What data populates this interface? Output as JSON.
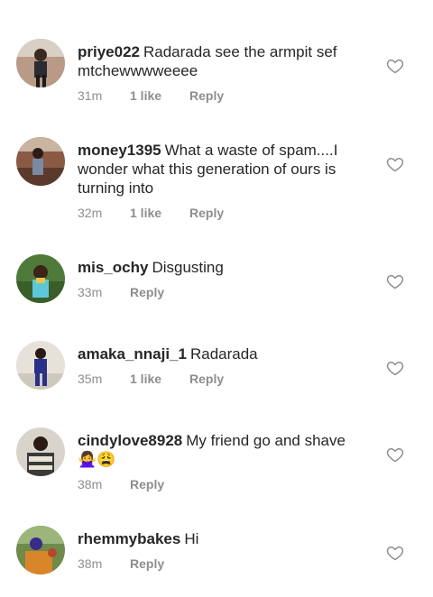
{
  "comments": [
    {
      "username": "priye022",
      "text": "Radarada see the armpit sef mtchewwwweeee",
      "time": "31m",
      "likes": "1 like",
      "reply": "Reply"
    },
    {
      "username": "money1395",
      "text": "What a waste of spam....I wonder what this generation of ours is turning into",
      "time": "32m",
      "likes": "1 like",
      "reply": "Reply"
    },
    {
      "username": "mis_ochy",
      "text": "Disgusting",
      "time": "33m",
      "likes": "",
      "reply": "Reply"
    },
    {
      "username": "amaka_nnaji_1",
      "text": "Radarada",
      "time": "35m",
      "likes": "1 like",
      "reply": "Reply"
    },
    {
      "username": "cindylove8928",
      "text": "My friend go and shave 🙅‍♀️😩",
      "time": "38m",
      "likes": "",
      "reply": "Reply"
    },
    {
      "username": "rhemmybakes",
      "text": "Hi",
      "time": "38m",
      "likes": "",
      "reply": "Reply"
    }
  ],
  "icons": {
    "like": "heart-outline-icon",
    "avatar": "profile-photo"
  }
}
